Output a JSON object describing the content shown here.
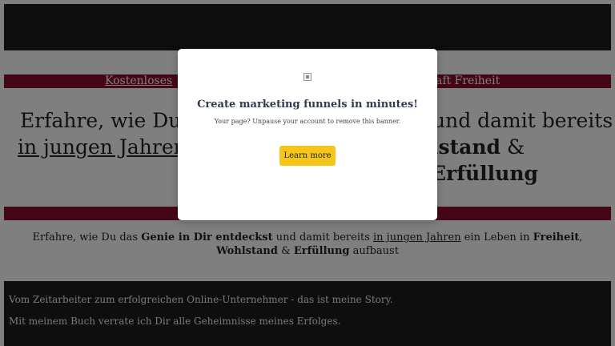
{
  "banner_top": {
    "left_text": "Kostenloses",
    "right_text": "haft Freiheit"
  },
  "headline": {
    "line1_left": "Erfahre, wie Du d",
    "line1_right": "und damit bereits",
    "line2_left": "in jungen Jahren",
    "line2_strong1": "lstand",
    "line2_amp": "&",
    "line2_strong2": "Erfüllung"
  },
  "subline": {
    "part1": "Erfahre, wie Du das",
    "strong1": "Genie in Dir entdeckst",
    "part2": "und damit bereits",
    "under1": "in jungen Jahren",
    "part3": "ein Leben in",
    "strong2": "Freiheit",
    "comma": ",",
    "strong3": "Wohlstand",
    "amp": "&",
    "strong4": "Erfüllung",
    "part4": "aufbaust"
  },
  "story": {
    "line1": "Vom Zeitarbeiter zum erfolgreichen Online-Unternehmer - das ist meine Story.",
    "line2": "Mit meinem Buch verrate ich Dir alle Geheimnisse meines Erfolges."
  },
  "modal": {
    "title": "Create marketing funnels in minutes!",
    "text": "Your page? Unpause your account to remove this banner.",
    "button_label": "Learn more"
  },
  "colors": {
    "banner": "#8a0f2e",
    "dark": "#1c1c1c",
    "button": "#f5c518"
  }
}
